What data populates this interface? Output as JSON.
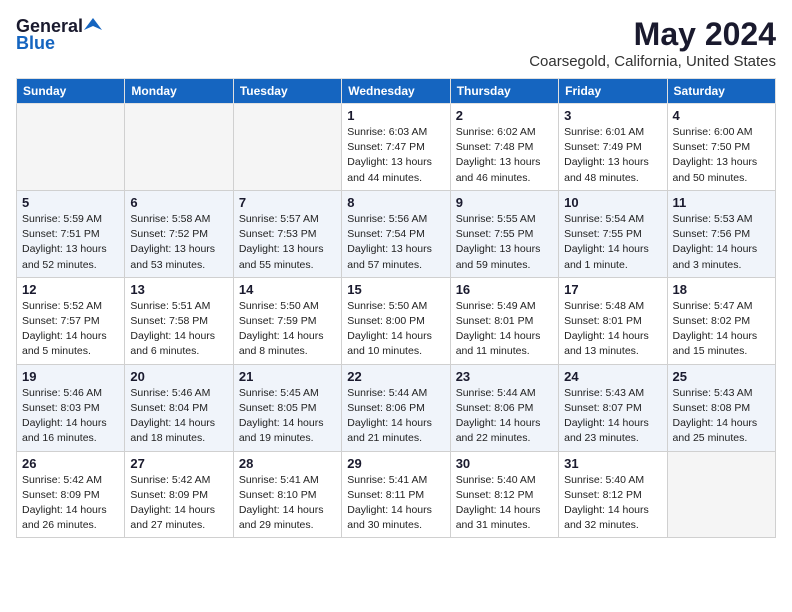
{
  "header": {
    "logo_general": "General",
    "logo_blue": "Blue",
    "title": "May 2024",
    "subtitle": "Coarsegold, California, United States"
  },
  "days_of_week": [
    "Sunday",
    "Monday",
    "Tuesday",
    "Wednesday",
    "Thursday",
    "Friday",
    "Saturday"
  ],
  "weeks": [
    [
      {
        "day": "",
        "info": ""
      },
      {
        "day": "",
        "info": ""
      },
      {
        "day": "",
        "info": ""
      },
      {
        "day": "1",
        "info": "Sunrise: 6:03 AM\nSunset: 7:47 PM\nDaylight: 13 hours\nand 44 minutes."
      },
      {
        "day": "2",
        "info": "Sunrise: 6:02 AM\nSunset: 7:48 PM\nDaylight: 13 hours\nand 46 minutes."
      },
      {
        "day": "3",
        "info": "Sunrise: 6:01 AM\nSunset: 7:49 PM\nDaylight: 13 hours\nand 48 minutes."
      },
      {
        "day": "4",
        "info": "Sunrise: 6:00 AM\nSunset: 7:50 PM\nDaylight: 13 hours\nand 50 minutes."
      }
    ],
    [
      {
        "day": "5",
        "info": "Sunrise: 5:59 AM\nSunset: 7:51 PM\nDaylight: 13 hours\nand 52 minutes."
      },
      {
        "day": "6",
        "info": "Sunrise: 5:58 AM\nSunset: 7:52 PM\nDaylight: 13 hours\nand 53 minutes."
      },
      {
        "day": "7",
        "info": "Sunrise: 5:57 AM\nSunset: 7:53 PM\nDaylight: 13 hours\nand 55 minutes."
      },
      {
        "day": "8",
        "info": "Sunrise: 5:56 AM\nSunset: 7:54 PM\nDaylight: 13 hours\nand 57 minutes."
      },
      {
        "day": "9",
        "info": "Sunrise: 5:55 AM\nSunset: 7:55 PM\nDaylight: 13 hours\nand 59 minutes."
      },
      {
        "day": "10",
        "info": "Sunrise: 5:54 AM\nSunset: 7:55 PM\nDaylight: 14 hours\nand 1 minute."
      },
      {
        "day": "11",
        "info": "Sunrise: 5:53 AM\nSunset: 7:56 PM\nDaylight: 14 hours\nand 3 minutes."
      }
    ],
    [
      {
        "day": "12",
        "info": "Sunrise: 5:52 AM\nSunset: 7:57 PM\nDaylight: 14 hours\nand 5 minutes."
      },
      {
        "day": "13",
        "info": "Sunrise: 5:51 AM\nSunset: 7:58 PM\nDaylight: 14 hours\nand 6 minutes."
      },
      {
        "day": "14",
        "info": "Sunrise: 5:50 AM\nSunset: 7:59 PM\nDaylight: 14 hours\nand 8 minutes."
      },
      {
        "day": "15",
        "info": "Sunrise: 5:50 AM\nSunset: 8:00 PM\nDaylight: 14 hours\nand 10 minutes."
      },
      {
        "day": "16",
        "info": "Sunrise: 5:49 AM\nSunset: 8:01 PM\nDaylight: 14 hours\nand 11 minutes."
      },
      {
        "day": "17",
        "info": "Sunrise: 5:48 AM\nSunset: 8:01 PM\nDaylight: 14 hours\nand 13 minutes."
      },
      {
        "day": "18",
        "info": "Sunrise: 5:47 AM\nSunset: 8:02 PM\nDaylight: 14 hours\nand 15 minutes."
      }
    ],
    [
      {
        "day": "19",
        "info": "Sunrise: 5:46 AM\nSunset: 8:03 PM\nDaylight: 14 hours\nand 16 minutes."
      },
      {
        "day": "20",
        "info": "Sunrise: 5:46 AM\nSunset: 8:04 PM\nDaylight: 14 hours\nand 18 minutes."
      },
      {
        "day": "21",
        "info": "Sunrise: 5:45 AM\nSunset: 8:05 PM\nDaylight: 14 hours\nand 19 minutes."
      },
      {
        "day": "22",
        "info": "Sunrise: 5:44 AM\nSunset: 8:06 PM\nDaylight: 14 hours\nand 21 minutes."
      },
      {
        "day": "23",
        "info": "Sunrise: 5:44 AM\nSunset: 8:06 PM\nDaylight: 14 hours\nand 22 minutes."
      },
      {
        "day": "24",
        "info": "Sunrise: 5:43 AM\nSunset: 8:07 PM\nDaylight: 14 hours\nand 23 minutes."
      },
      {
        "day": "25",
        "info": "Sunrise: 5:43 AM\nSunset: 8:08 PM\nDaylight: 14 hours\nand 25 minutes."
      }
    ],
    [
      {
        "day": "26",
        "info": "Sunrise: 5:42 AM\nSunset: 8:09 PM\nDaylight: 14 hours\nand 26 minutes."
      },
      {
        "day": "27",
        "info": "Sunrise: 5:42 AM\nSunset: 8:09 PM\nDaylight: 14 hours\nand 27 minutes."
      },
      {
        "day": "28",
        "info": "Sunrise: 5:41 AM\nSunset: 8:10 PM\nDaylight: 14 hours\nand 29 minutes."
      },
      {
        "day": "29",
        "info": "Sunrise: 5:41 AM\nSunset: 8:11 PM\nDaylight: 14 hours\nand 30 minutes."
      },
      {
        "day": "30",
        "info": "Sunrise: 5:40 AM\nSunset: 8:12 PM\nDaylight: 14 hours\nand 31 minutes."
      },
      {
        "day": "31",
        "info": "Sunrise: 5:40 AM\nSunset: 8:12 PM\nDaylight: 14 hours\nand 32 minutes."
      },
      {
        "day": "",
        "info": ""
      }
    ]
  ]
}
